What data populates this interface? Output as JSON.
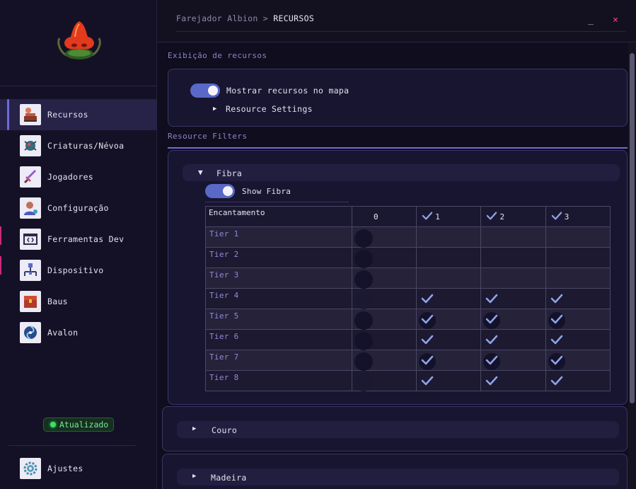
{
  "titlebar": {
    "breadcrumb_app": "Farejador Albion",
    "breadcrumb_sep": " > ",
    "breadcrumb_current": "RECURSOS",
    "minimize_label": "_",
    "close_label": "×"
  },
  "sidebar": {
    "items": [
      {
        "label": "Recursos",
        "icon": "resources-icon",
        "active": true
      },
      {
        "label": "Criaturas/Névoa",
        "icon": "creature-icon",
        "active": false
      },
      {
        "label": "Jogadores",
        "icon": "sword-icon",
        "active": false
      },
      {
        "label": "Configuração",
        "icon": "user-config-icon",
        "active": false
      },
      {
        "label": "Ferramentas Dev",
        "icon": "code-window-icon",
        "active": false
      },
      {
        "label": "Dispositivo",
        "icon": "network-device-icon",
        "active": false
      },
      {
        "label": "Baus",
        "icon": "chest-icon",
        "active": false
      },
      {
        "label": "Avalon",
        "icon": "portal-icon",
        "active": false
      }
    ],
    "status": "Atualizado",
    "settings_label": "Ajustes",
    "status_color": "#39e262"
  },
  "main": {
    "display_section_title": "Exibição de recursos",
    "show_resources_label": "Mostrar recursos no mapa",
    "show_resources_on": true,
    "resource_settings_label": "Resource Settings",
    "filters_section_title": "Resource Filters",
    "groups": [
      {
        "name": "Fibra",
        "expanded": true
      },
      {
        "name": "Couro",
        "expanded": false
      },
      {
        "name": "Madeira",
        "expanded": false
      }
    ],
    "fibra": {
      "show_label": "Show Fibra",
      "show_on": true,
      "table": {
        "header_label": "Encantamento",
        "columns": [
          "0",
          "1",
          "2",
          "3"
        ],
        "rows": [
          {
            "tier": "Tier 1",
            "cells": [
              "dot",
              "",
              "",
              ""
            ]
          },
          {
            "tier": "Tier 2",
            "cells": [
              "dot",
              "",
              "",
              ""
            ]
          },
          {
            "tier": "Tier 3",
            "cells": [
              "dot",
              "",
              "",
              ""
            ]
          },
          {
            "tier": "Tier 4",
            "cells": [
              "dot-dim",
              "check",
              "check",
              "check"
            ]
          },
          {
            "tier": "Tier 5",
            "cells": [
              "dot",
              "check-circle",
              "check-circle",
              "check-circle"
            ]
          },
          {
            "tier": "Tier 6",
            "cells": [
              "dot",
              "check",
              "check",
              "check"
            ]
          },
          {
            "tier": "Tier 7",
            "cells": [
              "dot",
              "check-circle",
              "check-circle",
              "check-circle"
            ]
          },
          {
            "tier": "Tier 8",
            "cells": [
              "dot-dim",
              "check",
              "check",
              "check"
            ]
          }
        ]
      }
    },
    "accent_color": "#6f6bd8",
    "toggle_color": "#5a68c8",
    "check_color": "#8ea4e8"
  }
}
